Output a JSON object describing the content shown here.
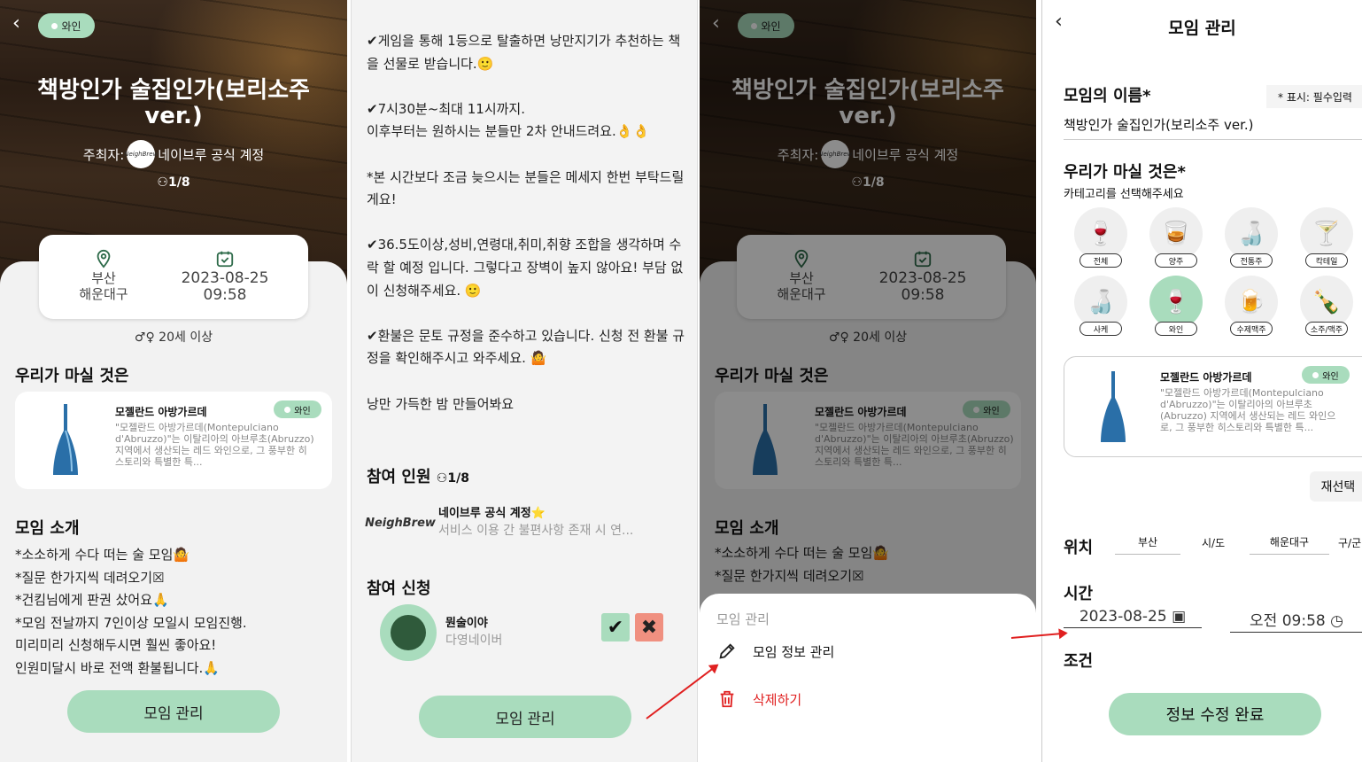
{
  "screen1": {
    "tag": "와인",
    "title": "책방인가 술집인가(보리소주 ver.)",
    "host_prefix": "주최자:",
    "host_logo": "NeighBrew",
    "host_name": "네이브루 공식 계정",
    "count": "1/8",
    "location": [
      "부산",
      "해운대구"
    ],
    "date": "2023-08-25",
    "time": "09:58",
    "age": "20세 이상",
    "drink_section": "우리가 마실 것은",
    "drink": {
      "name": "모젤란드 아방가르데",
      "desc": "\"모젤란드 아방가르데(Montepulciano d'Abruzzo)\"는 이탈리아의 아브루초(Abruzzo) 지역에서 생산되는 레드 와인으로, 그 풍부한 히스토리와 특별한 특...",
      "tag": "와인"
    },
    "intro_section": "모임 소개",
    "intro_lines": [
      "*소소하게 수다 떠는 술 모임🤷",
      "*질문 한가지씩 데려오기☒",
      "*건킴님에게 판권 샀어요🙏",
      "*모임 전날까지 7인이상 모일시 모임진행.",
      "미리미리 신청해두시면 훨씬 좋아요!",
      "인원미달시 바로 전액 환불됩니다.🙏"
    ],
    "manage_button": "모임 관리"
  },
  "screen2": {
    "paragraphs": [
      "✔게임을 통해 1등으로 탈출하면 낭만지기가 추천하는 책을 선물로 받습니다.🙂",
      "✔7시30분~최대 11시까지.\n이후부터는 원하시는 분들만 2차 안내드려요.👌👌",
      "*본 시간보다 조금 늦으시는 분들은 메세지 한번 부탁드릴게요!",
      "✔36.5도이상,성비,연령대,취미,취향 조합을 생각하며 수락 할 예정 입니다. 그렇다고 장벽이 높지 않아요! 부담 없이 신청해주세요. 🙂",
      "✔환불은 문토 규정을 준수하고 있습니다. 신청 전 환불 규정을 확인해주시고 와주세요. 🤷",
      "낭만 가득한 밤 만들어봐요"
    ],
    "members_title": "참여 인원",
    "members_count": "1/8",
    "member": {
      "logo": "NeighBrew",
      "name": "네이브루 공식 계정⭐",
      "sub": "서비스 이용 간 불편사항 존재 시 연..."
    },
    "apply_title": "참여 신청",
    "applicant": {
      "name": "뭔술이야",
      "sub": "다영네이버"
    },
    "manage_button": "모임 관리"
  },
  "screen3": {
    "menu_title": "모임 관리",
    "edit_label": "모임 정보 관리",
    "delete_label": "삭제하기"
  },
  "screen4": {
    "title": "모임 관리",
    "name_label": "모임의 이름*",
    "required_note": "* 표시: 필수입력",
    "name_value": "책방인가 술집인가(보리소주 ver.)",
    "drink_label": "우리가 마실 것은*",
    "drink_hint": "카테고리를 선택해주세요",
    "categories": [
      {
        "label": "전체",
        "glyph": "🍷"
      },
      {
        "label": "양주",
        "glyph": "🥃"
      },
      {
        "label": "전통주",
        "glyph": "🍶"
      },
      {
        "label": "칵테일",
        "glyph": "🍸"
      },
      {
        "label": "사케",
        "glyph": "🍶"
      },
      {
        "label": "와인",
        "glyph": "🍷"
      },
      {
        "label": "수제맥주",
        "glyph": "🍺"
      },
      {
        "label": "소주/맥주",
        "glyph": "🍾"
      }
    ],
    "selected_category": "와인",
    "reselect": "재선택",
    "location_label": "위치",
    "city": "부산",
    "city_unit": "시/도",
    "district": "해운대구",
    "district_unit": "구/군",
    "time_label": "시간",
    "date": "2023-08-25",
    "time": "오전 09:58",
    "cond_label": "조건",
    "submit": "정보 수정 완료"
  },
  "colors": {
    "accent": "#a9dcbd",
    "danger": "#e02020"
  }
}
